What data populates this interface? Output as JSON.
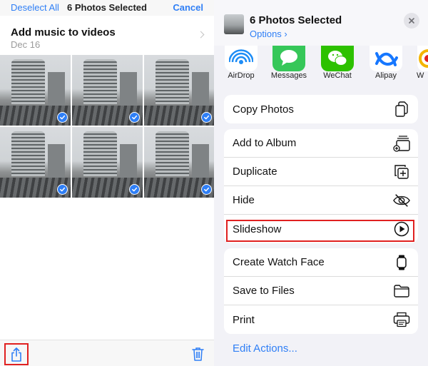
{
  "left": {
    "nav": {
      "deselect": "Deselect All",
      "title": "6 Photos Selected",
      "cancel": "Cancel"
    },
    "album": {
      "title": "Add music to videos",
      "date": "Dec 16"
    },
    "photos": [
      {
        "selected": true
      },
      {
        "selected": true
      },
      {
        "selected": true
      },
      {
        "selected": true
      },
      {
        "selected": true
      },
      {
        "selected": true
      }
    ],
    "toolbar": {
      "share_icon": "share-icon",
      "trash_icon": "trash-icon"
    }
  },
  "right": {
    "header": {
      "title": "6 Photos Selected",
      "options": "Options ›",
      "close_icon": "close-icon"
    },
    "apps": [
      {
        "label": "AirDrop",
        "icon": "airdrop-icon",
        "color": "#1e8df6"
      },
      {
        "label": "Messages",
        "icon": "messages-icon",
        "color": "#36c759"
      },
      {
        "label": "WeChat",
        "icon": "wechat-icon",
        "color": "#2dc100"
      },
      {
        "label": "Alipay",
        "icon": "alipay-icon",
        "color": "#1677ff"
      },
      {
        "label": "W",
        "icon": "weibo-icon",
        "color": "#f4b400"
      }
    ],
    "groups": [
      [
        {
          "label": "Copy Photos",
          "icon": "copy-icon"
        }
      ],
      [
        {
          "label": "Add to Album",
          "icon": "add-album-icon"
        },
        {
          "label": "Duplicate",
          "icon": "duplicate-icon"
        },
        {
          "label": "Hide",
          "icon": "hide-eye-icon"
        },
        {
          "label": "Slideshow",
          "icon": "play-circle-icon"
        }
      ],
      [
        {
          "label": "Create Watch Face",
          "icon": "watch-icon"
        },
        {
          "label": "Save to Files",
          "icon": "folder-icon"
        },
        {
          "label": "Print",
          "icon": "printer-icon"
        }
      ]
    ],
    "edit_actions": "Edit Actions..."
  },
  "colors": {
    "accent": "#2f7ff6",
    "highlight": "#e02020"
  }
}
